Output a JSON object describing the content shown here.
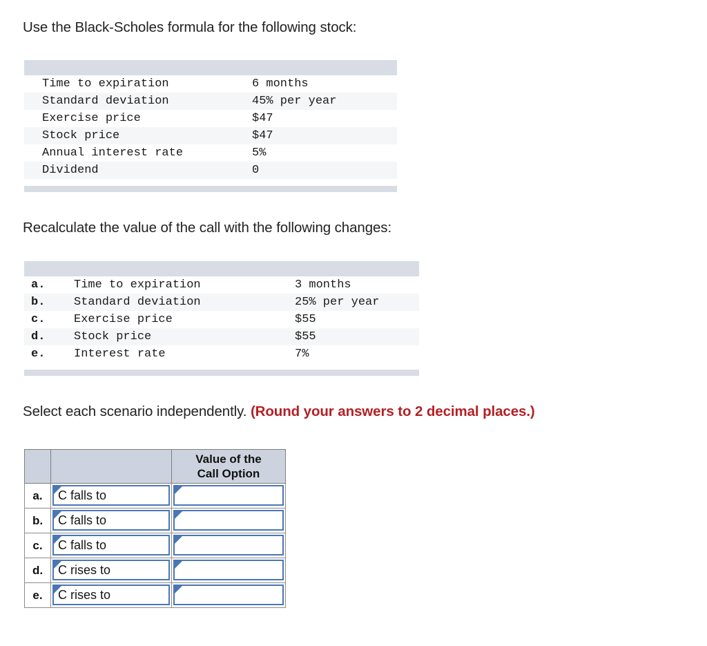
{
  "intro": {
    "line1": "Use the Black-Scholes formula for the following stock:",
    "line2": "Recalculate the value of the call with the following changes:",
    "line3_plain": "Select each scenario independently. ",
    "line3_emphasis": "(Round your answers to 2 decimal places.)",
    "emphasis_color": "#b42025"
  },
  "stock_table": {
    "rows": [
      {
        "label": "Time to expiration",
        "value": "6 months"
      },
      {
        "label": "Standard deviation",
        "value": "45% per year"
      },
      {
        "label": "Exercise price",
        "value": "$47"
      },
      {
        "label": "Stock price",
        "value": "$47"
      },
      {
        "label": "Annual interest rate",
        "value": "5%"
      },
      {
        "label": "Dividend",
        "value": "0"
      }
    ],
    "header_color": "#d7dce5",
    "stripe_color": "#f5f6f7"
  },
  "changes_table": {
    "rows": [
      {
        "letter": "a.",
        "label": "Time to expiration",
        "value": "3 months"
      },
      {
        "letter": "b.",
        "label": "Standard deviation",
        "value": "25% per year"
      },
      {
        "letter": "c.",
        "label": "Exercise price",
        "value": "$55"
      },
      {
        "letter": "d.",
        "label": "Stock price",
        "value": "$55"
      },
      {
        "letter": "e.",
        "label": "Interest rate",
        "value": "7%"
      }
    ],
    "header_color": "#d7dce5",
    "stripe_color": "#f5f6f7"
  },
  "answer_table": {
    "header": {
      "col1": "",
      "col2": "",
      "col3_line1": "Value of the",
      "col3_line2": "Call Option"
    },
    "header_color": "#ccd3de",
    "input_border_color": "#4a76b4",
    "rows": [
      {
        "letter": "a.",
        "description": "C falls to",
        "answer": ""
      },
      {
        "letter": "b.",
        "description": "C falls to",
        "answer": ""
      },
      {
        "letter": "c.",
        "description": "C falls to",
        "answer": ""
      },
      {
        "letter": "d.",
        "description": "C rises to",
        "answer": ""
      },
      {
        "letter": "e.",
        "description": "C rises to",
        "answer": ""
      }
    ]
  }
}
